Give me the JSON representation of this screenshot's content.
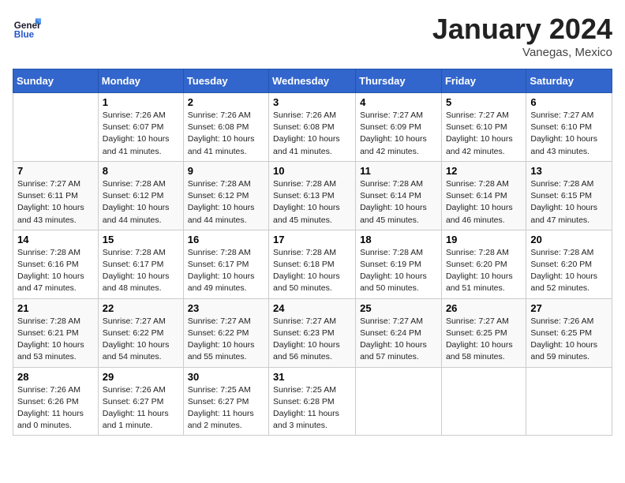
{
  "logo": {
    "general": "General",
    "blue": "Blue"
  },
  "title": "January 2024",
  "location": "Vanegas, Mexico",
  "days_of_week": [
    "Sunday",
    "Monday",
    "Tuesday",
    "Wednesday",
    "Thursday",
    "Friday",
    "Saturday"
  ],
  "weeks": [
    [
      {
        "day": "",
        "info": ""
      },
      {
        "day": "1",
        "info": "Sunrise: 7:26 AM\nSunset: 6:07 PM\nDaylight: 10 hours and 41 minutes."
      },
      {
        "day": "2",
        "info": "Sunrise: 7:26 AM\nSunset: 6:08 PM\nDaylight: 10 hours and 41 minutes."
      },
      {
        "day": "3",
        "info": "Sunrise: 7:26 AM\nSunset: 6:08 PM\nDaylight: 10 hours and 41 minutes."
      },
      {
        "day": "4",
        "info": "Sunrise: 7:27 AM\nSunset: 6:09 PM\nDaylight: 10 hours and 42 minutes."
      },
      {
        "day": "5",
        "info": "Sunrise: 7:27 AM\nSunset: 6:10 PM\nDaylight: 10 hours and 42 minutes."
      },
      {
        "day": "6",
        "info": "Sunrise: 7:27 AM\nSunset: 6:10 PM\nDaylight: 10 hours and 43 minutes."
      }
    ],
    [
      {
        "day": "7",
        "info": "Sunrise: 7:27 AM\nSunset: 6:11 PM\nDaylight: 10 hours and 43 minutes."
      },
      {
        "day": "8",
        "info": "Sunrise: 7:28 AM\nSunset: 6:12 PM\nDaylight: 10 hours and 44 minutes."
      },
      {
        "day": "9",
        "info": "Sunrise: 7:28 AM\nSunset: 6:12 PM\nDaylight: 10 hours and 44 minutes."
      },
      {
        "day": "10",
        "info": "Sunrise: 7:28 AM\nSunset: 6:13 PM\nDaylight: 10 hours and 45 minutes."
      },
      {
        "day": "11",
        "info": "Sunrise: 7:28 AM\nSunset: 6:14 PM\nDaylight: 10 hours and 45 minutes."
      },
      {
        "day": "12",
        "info": "Sunrise: 7:28 AM\nSunset: 6:14 PM\nDaylight: 10 hours and 46 minutes."
      },
      {
        "day": "13",
        "info": "Sunrise: 7:28 AM\nSunset: 6:15 PM\nDaylight: 10 hours and 47 minutes."
      }
    ],
    [
      {
        "day": "14",
        "info": "Sunrise: 7:28 AM\nSunset: 6:16 PM\nDaylight: 10 hours and 47 minutes."
      },
      {
        "day": "15",
        "info": "Sunrise: 7:28 AM\nSunset: 6:17 PM\nDaylight: 10 hours and 48 minutes."
      },
      {
        "day": "16",
        "info": "Sunrise: 7:28 AM\nSunset: 6:17 PM\nDaylight: 10 hours and 49 minutes."
      },
      {
        "day": "17",
        "info": "Sunrise: 7:28 AM\nSunset: 6:18 PM\nDaylight: 10 hours and 50 minutes."
      },
      {
        "day": "18",
        "info": "Sunrise: 7:28 AM\nSunset: 6:19 PM\nDaylight: 10 hours and 50 minutes."
      },
      {
        "day": "19",
        "info": "Sunrise: 7:28 AM\nSunset: 6:20 PM\nDaylight: 10 hours and 51 minutes."
      },
      {
        "day": "20",
        "info": "Sunrise: 7:28 AM\nSunset: 6:20 PM\nDaylight: 10 hours and 52 minutes."
      }
    ],
    [
      {
        "day": "21",
        "info": "Sunrise: 7:28 AM\nSunset: 6:21 PM\nDaylight: 10 hours and 53 minutes."
      },
      {
        "day": "22",
        "info": "Sunrise: 7:27 AM\nSunset: 6:22 PM\nDaylight: 10 hours and 54 minutes."
      },
      {
        "day": "23",
        "info": "Sunrise: 7:27 AM\nSunset: 6:22 PM\nDaylight: 10 hours and 55 minutes."
      },
      {
        "day": "24",
        "info": "Sunrise: 7:27 AM\nSunset: 6:23 PM\nDaylight: 10 hours and 56 minutes."
      },
      {
        "day": "25",
        "info": "Sunrise: 7:27 AM\nSunset: 6:24 PM\nDaylight: 10 hours and 57 minutes."
      },
      {
        "day": "26",
        "info": "Sunrise: 7:27 AM\nSunset: 6:25 PM\nDaylight: 10 hours and 58 minutes."
      },
      {
        "day": "27",
        "info": "Sunrise: 7:26 AM\nSunset: 6:25 PM\nDaylight: 10 hours and 59 minutes."
      }
    ],
    [
      {
        "day": "28",
        "info": "Sunrise: 7:26 AM\nSunset: 6:26 PM\nDaylight: 11 hours and 0 minutes."
      },
      {
        "day": "29",
        "info": "Sunrise: 7:26 AM\nSunset: 6:27 PM\nDaylight: 11 hours and 1 minute."
      },
      {
        "day": "30",
        "info": "Sunrise: 7:25 AM\nSunset: 6:27 PM\nDaylight: 11 hours and 2 minutes."
      },
      {
        "day": "31",
        "info": "Sunrise: 7:25 AM\nSunset: 6:28 PM\nDaylight: 11 hours and 3 minutes."
      },
      {
        "day": "",
        "info": ""
      },
      {
        "day": "",
        "info": ""
      },
      {
        "day": "",
        "info": ""
      }
    ]
  ]
}
